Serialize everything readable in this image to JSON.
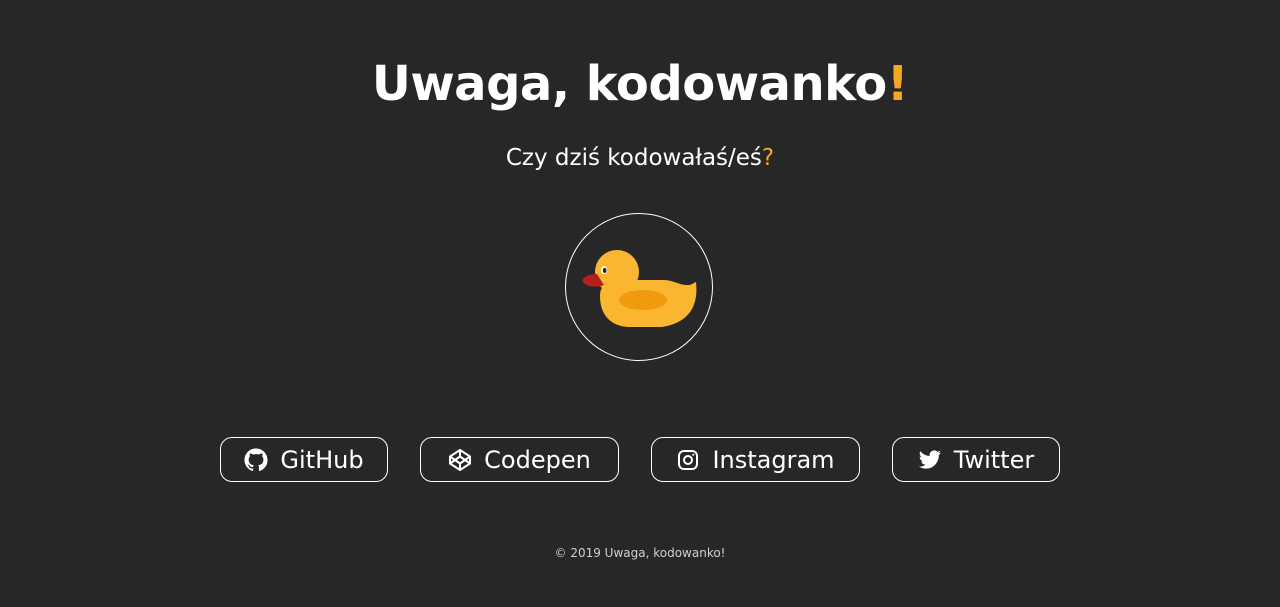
{
  "header": {
    "title_text": "Uwaga, kodowanko",
    "title_mark": "!",
    "subtitle_text": "Czy dziś kodowałaś/eś",
    "subtitle_mark": "?"
  },
  "colors": {
    "background": "#272727",
    "accent": "#f5a623",
    "text": "#ffffff"
  },
  "logo": {
    "icon": "rubber-duck-icon"
  },
  "links": [
    {
      "label": "GitHub",
      "icon": "github-icon"
    },
    {
      "label": "Codepen",
      "icon": "codepen-icon"
    },
    {
      "label": "Instagram",
      "icon": "instagram-icon"
    },
    {
      "label": "Twitter",
      "icon": "twitter-icon"
    }
  ],
  "footer": {
    "text": "© 2019 Uwaga, kodowanko!"
  }
}
